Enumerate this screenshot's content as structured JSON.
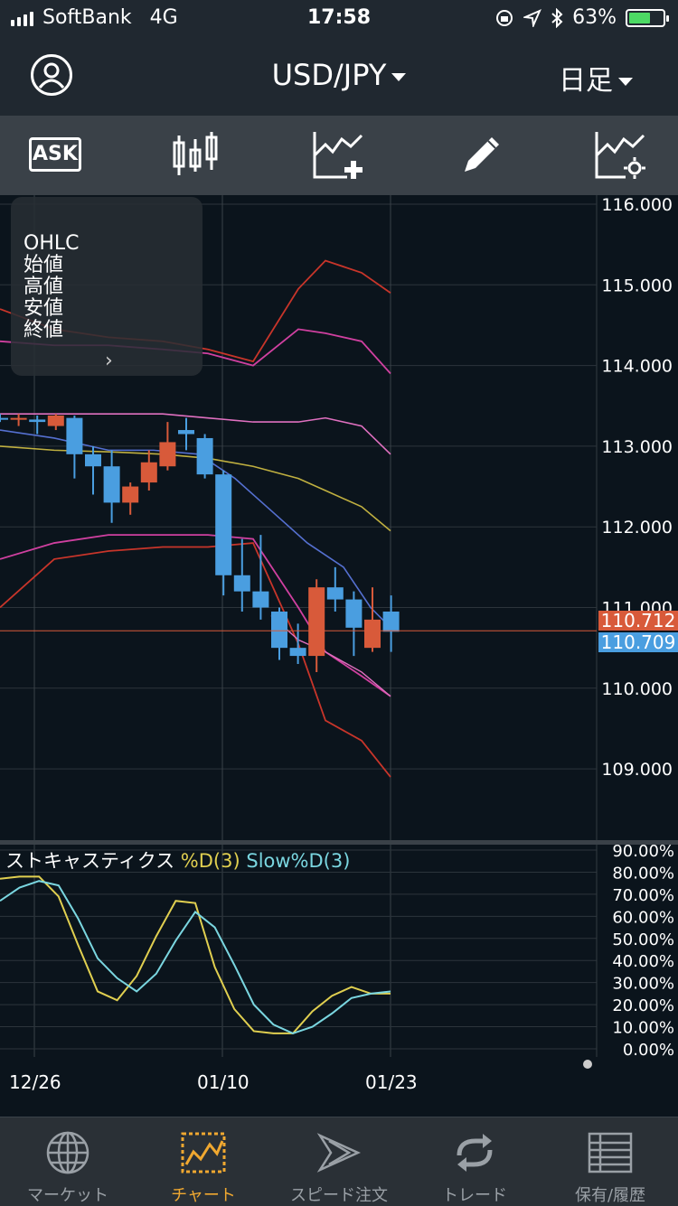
{
  "status_bar": {
    "carrier": "SoftBank",
    "network": "4G",
    "time": "17:58",
    "battery": "63%",
    "battery_level": 0.63
  },
  "header": {
    "pair": "USD/JPY",
    "period": "日足"
  },
  "toolbar": {
    "ask_label": "ASK"
  },
  "ohlc_panel": {
    "title": "OHLC",
    "open": "始値",
    "high": "高値",
    "low": "安値",
    "close": "終値"
  },
  "colors": {
    "bid": "#d85a3a",
    "ask": "#4a9ee0",
    "down_candle": "#4a9ee0",
    "up_candle": "#d85a3a",
    "active_tab": "#f0a830"
  },
  "chart_data": [
    {
      "type": "candlestick",
      "x_ticks": [
        "12/26",
        "01/10",
        "01/23"
      ],
      "y_ticks": [
        "116.000",
        "115.000",
        "114.000",
        "113.000",
        "112.000",
        "111.000",
        "110.000",
        "109.000"
      ],
      "ylim": [
        108.3,
        116.1
      ],
      "current_bid": "110.712",
      "current_ask": "110.709",
      "candles": [
        {
          "o": 113.35,
          "h": 113.4,
          "l": 113.3,
          "c": 113.33
        },
        {
          "o": 113.33,
          "h": 113.4,
          "l": 113.25,
          "c": 113.35
        },
        {
          "o": 113.33,
          "h": 113.38,
          "l": 113.15,
          "c": 113.3
        },
        {
          "o": 113.25,
          "h": 113.4,
          "l": 113.2,
          "c": 113.38
        },
        {
          "o": 113.35,
          "h": 113.38,
          "l": 112.6,
          "c": 112.9
        },
        {
          "o": 112.9,
          "h": 113.0,
          "l": 112.4,
          "c": 112.75
        },
        {
          "o": 112.75,
          "h": 112.95,
          "l": 112.05,
          "c": 112.3
        },
        {
          "o": 112.3,
          "h": 112.55,
          "l": 112.15,
          "c": 112.5
        },
        {
          "o": 112.55,
          "h": 112.95,
          "l": 112.45,
          "c": 112.8
        },
        {
          "o": 112.75,
          "h": 113.3,
          "l": 112.7,
          "c": 113.05
        },
        {
          "o": 113.2,
          "h": 113.35,
          "l": 112.95,
          "c": 113.15
        },
        {
          "o": 113.1,
          "h": 113.15,
          "l": 112.6,
          "c": 112.65
        },
        {
          "o": 112.65,
          "h": 112.7,
          "l": 111.15,
          "c": 111.4
        },
        {
          "o": 111.4,
          "h": 111.85,
          "l": 110.95,
          "c": 111.2
        },
        {
          "o": 111.2,
          "h": 111.9,
          "l": 110.85,
          "c": 111.0
        },
        {
          "o": 110.95,
          "h": 111.0,
          "l": 110.35,
          "c": 110.5
        },
        {
          "o": 110.5,
          "h": 110.8,
          "l": 110.3,
          "c": 110.4
        },
        {
          "o": 110.4,
          "h": 111.35,
          "l": 110.2,
          "c": 111.25
        },
        {
          "o": 111.25,
          "h": 111.5,
          "l": 110.95,
          "c": 111.1
        },
        {
          "o": 111.1,
          "h": 111.2,
          "l": 110.4,
          "c": 110.75
        },
        {
          "o": 110.5,
          "h": 111.25,
          "l": 110.45,
          "c": 110.85
        },
        {
          "o": 110.95,
          "h": 111.15,
          "l": 110.45,
          "c": 110.7
        }
      ],
      "bollinger": {
        "sma": [
          113.0,
          112.95,
          112.93,
          112.9,
          112.85,
          112.75,
          112.6,
          112.45,
          112.25,
          111.95
        ],
        "upper2": [
          113.4,
          113.4,
          113.4,
          113.4,
          113.35,
          113.3,
          113.3,
          113.35,
          113.25,
          112.9
        ],
        "lower2": [
          111.6,
          111.8,
          111.9,
          111.9,
          111.9,
          111.85,
          111.0,
          110.45,
          110.15,
          109.9
        ],
        "upper3": [
          114.3,
          114.25,
          114.25,
          114.2,
          114.15,
          114.0,
          114.45,
          114.4,
          114.3,
          113.9
        ],
        "lower3": [
          111.0,
          111.6,
          111.7,
          111.75,
          111.75,
          111.8,
          110.55,
          109.6,
          109.35,
          108.9
        ],
        "red_upper": [
          114.7,
          114.45,
          114.35,
          114.3,
          114.2,
          114.05,
          114.95,
          115.3,
          115.15,
          114.9
        ]
      }
    },
    {
      "type": "line",
      "title": "ストキャスティクス",
      "series": [
        {
          "name": "%D(3)",
          "color": "#e0cf50",
          "values": [
            77,
            78,
            78,
            69,
            47,
            26,
            22,
            33,
            51,
            67,
            66,
            37,
            18,
            8,
            7,
            7,
            17,
            24,
            28,
            25,
            25
          ]
        },
        {
          "name": "Slow%D(3)",
          "color": "#7ad6e0",
          "values": [
            67,
            73,
            76,
            74,
            59,
            41,
            32,
            26,
            34,
            49,
            62,
            55,
            38,
            20,
            11,
            7,
            10,
            16,
            23,
            25,
            26
          ]
        }
      ],
      "y_ticks": [
        "90.00%",
        "80.00%",
        "70.00%",
        "60.00%",
        "50.00%",
        "40.00%",
        "30.00%",
        "20.00%",
        "10.00%",
        "0.00%"
      ],
      "ylim": [
        0,
        90
      ]
    }
  ],
  "tabs": [
    {
      "label": "マーケット",
      "icon": "globe-icon"
    },
    {
      "label": "チャート",
      "icon": "chart-icon"
    },
    {
      "label": "スピード注文",
      "icon": "speed-icon"
    },
    {
      "label": "トレード",
      "icon": "trade-icon"
    },
    {
      "label": "保有/履歴",
      "icon": "list-icon"
    }
  ]
}
